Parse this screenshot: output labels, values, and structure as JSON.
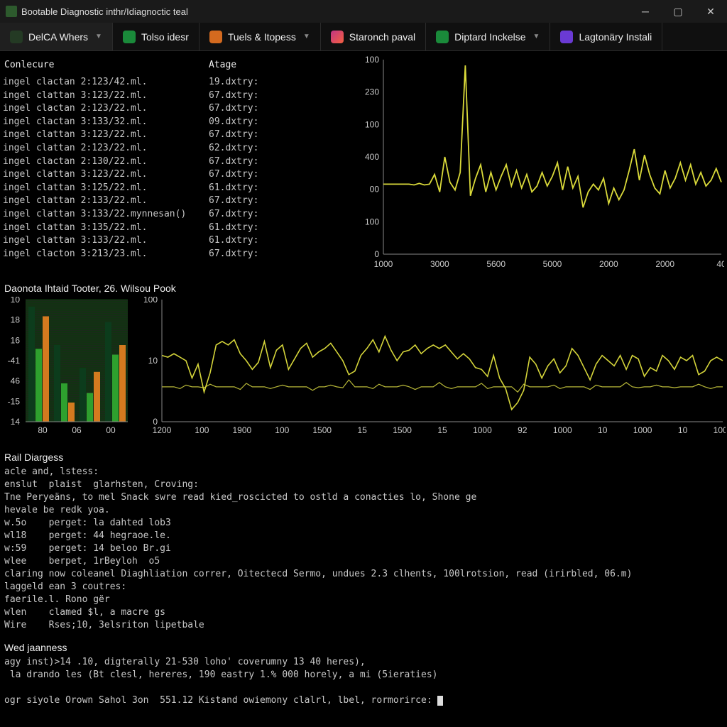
{
  "window": {
    "title": "Bootable Diagnostic inthr/Idiagnoctic teal"
  },
  "tabs": [
    {
      "label": "DelCA Whers",
      "icon_bg": "#243a24",
      "chevron": true
    },
    {
      "label": "Tolso idesr",
      "icon_bg": "#1a8a3a",
      "chevron": false
    },
    {
      "label": "Tuels & Itopess",
      "icon_bg": "#d46a1f",
      "chevron": true
    },
    {
      "label": "Staronch paval",
      "icon_bg": "linear-gradient(135deg,#c13584,#f56040)",
      "chevron": false
    },
    {
      "label": "Diptard Inckelse",
      "icon_bg": "#1a8a3a",
      "chevron": true
    },
    {
      "label": "Lagtonäry Instali",
      "icon_bg": "#6a3ad4",
      "chevron": false
    }
  ],
  "log": {
    "h1": "Conlecure",
    "h2": "Atage",
    "rows": [
      {
        "c1": "ingel clactan 2:123/42.ml.",
        "c2": "19.dxtry:"
      },
      {
        "c1": "ingel clattan 3:123/22.ml.",
        "c2": "67.dxtry:"
      },
      {
        "c1": "ingel clactan 2:123/22.ml.",
        "c2": "67.dxtry:"
      },
      {
        "c1": "ingel clactan 3:133/32.ml.",
        "c2": "09.dxtry:"
      },
      {
        "c1": "ingel clattan 3:123/22.ml.",
        "c2": "67.dxtry:"
      },
      {
        "c1": "ingel clattan 2:123/22.ml.",
        "c2": "62.dxtry:"
      },
      {
        "c1": "ingel clactan 2:130/22.ml.",
        "c2": "67.dxtry:"
      },
      {
        "c1": "ingel clattan 3:123/22.ml.",
        "c2": "67.dxtry:"
      },
      {
        "c1": "ingel clattan 3:125/22.ml.",
        "c2": "61.dxtry:"
      },
      {
        "c1": "ingel clattan 2:133/22.ml.",
        "c2": "67.dxtry:"
      },
      {
        "c1": "ingel clattan 3:133/22.mynnesan()",
        "c2": "67.dxtry:"
      },
      {
        "c1": "ingel clattan 3:135/22.ml.",
        "c2": "61.dxtry:"
      },
      {
        "c1": "ingel clattan 3:133/22.ml.",
        "c2": "61.dxtry:"
      },
      {
        "c1": "ingel clacton 3:213/23.ml.",
        "c2": "67.dxtry:"
      }
    ]
  },
  "mid_label": "Daonota Ihtaid Tooter, 26. Wilsou Pook",
  "section1": "Rail Diargess",
  "console1_lines": [
    "acle and, lstess:",
    "enslut  plaist  glarhsten, Croving:",
    "Tne Peryeäns, to mel Snack swre read kied_roscicted to ostld a conacties lo, Shone ge",
    "hevale be redk yoa.",
    "w.5o    perget: la dahted lob3",
    "wl18    perget: 44 hegraoe.le.",
    "w:59    perget: 14 beloo Br.gi",
    "wlee    berpet, 1rBeyloh  o5",
    "claring now coleanel Diaghliation correr, Oitectecd Sermo, undues 2.3 clhents, 100lrotsion, read (irirbled, 06.m)",
    "laggeld ean 3 coutres:",
    "faerile.l. Rono gër",
    "wlen    clamed $l, a macre gs",
    "Wire    Rses;10, 3elsriton lipetbale"
  ],
  "section2": "Wed jaanness",
  "console2_lines": [
    "agy inst)>14 .10, digterally 21-530 loho' coverumny 13 40 heres),",
    " la drando les (Bt clesl, hereres, 190 eastry 1.% 000 horely, a mi (5ieraties)",
    "",
    "ogr siyole Orown Sahol 3on  551.12 Kistand owiemony clalrl, lbel, rormorirce: "
  ],
  "chart_data": [
    {
      "type": "line",
      "title": "",
      "xticks": [
        "1000",
        "3000",
        "5600",
        "5000",
        "2000",
        "2000",
        "40"
      ],
      "yticks": [
        "0",
        "100",
        "00",
        "400",
        "100",
        "230",
        "100"
      ],
      "ylim": [
        0,
        500
      ],
      "x": [
        0,
        1,
        2,
        3,
        4,
        5,
        6,
        7,
        8,
        9,
        10,
        11,
        12,
        13,
        14,
        15,
        16,
        17,
        18,
        19,
        20,
        21,
        22,
        23,
        24,
        25,
        26,
        27,
        28,
        29,
        30,
        31,
        32,
        33,
        34,
        35,
        36,
        37,
        38,
        39,
        40,
        41,
        42,
        43,
        44,
        45,
        46,
        47,
        48,
        49,
        50,
        51,
        52,
        53,
        54,
        55,
        56,
        57,
        58,
        59,
        60,
        61,
        62,
        63,
        64,
        65,
        66
      ],
      "y": [
        180,
        180,
        180,
        180,
        180,
        180,
        178,
        182,
        178,
        180,
        205,
        160,
        250,
        185,
        165,
        210,
        485,
        150,
        195,
        230,
        160,
        210,
        165,
        200,
        230,
        175,
        215,
        170,
        205,
        160,
        175,
        210,
        175,
        200,
        235,
        165,
        225,
        170,
        200,
        120,
        160,
        180,
        165,
        195,
        130,
        170,
        140,
        165,
        215,
        270,
        190,
        255,
        205,
        170,
        155,
        215,
        170,
        195,
        235,
        190,
        230,
        180,
        210,
        175,
        190,
        220,
        185
      ]
    },
    {
      "type": "bar",
      "yticks": [
        "14",
        "-15",
        "46",
        "-41",
        "16",
        "18",
        "10"
      ],
      "xticks": [
        "80",
        "06",
        "00"
      ],
      "series": [
        {
          "name": "dark",
          "values": [
            60,
            40,
            28,
            52
          ]
        },
        {
          "name": "green",
          "values": [
            38,
            20,
            15,
            35
          ]
        },
        {
          "name": "orange",
          "values": [
            55,
            10,
            26,
            40
          ]
        }
      ]
    },
    {
      "type": "line",
      "yticks": [
        "0",
        "10",
        "100"
      ],
      "xticks": [
        "1200",
        "100",
        "1900",
        "100",
        "1500",
        "15",
        "1500",
        "15",
        "1000",
        "92",
        "1000",
        "10",
        "1000",
        "10",
        "1000"
      ],
      "ylim": [
        -40,
        100
      ],
      "x": [
        0,
        1,
        2,
        3,
        4,
        5,
        6,
        7,
        8,
        9,
        10,
        11,
        12,
        13,
        14,
        15,
        16,
        17,
        18,
        19,
        20,
        21,
        22,
        23,
        24,
        25,
        26,
        27,
        28,
        29,
        30,
        31,
        32,
        33,
        34,
        35,
        36,
        37,
        38,
        39,
        40,
        41,
        42,
        43,
        44,
        45,
        46,
        47,
        48,
        49,
        50,
        51,
        52,
        53,
        54,
        55,
        56,
        57,
        58,
        59,
        60,
        61,
        62,
        63,
        64,
        65,
        66,
        67,
        68,
        69,
        70,
        71,
        72,
        73,
        74,
        75,
        76,
        77,
        78,
        79,
        80,
        81,
        82,
        83,
        84,
        85,
        86,
        87,
        88,
        89,
        90,
        91,
        92,
        93
      ],
      "y": [
        36,
        34,
        38,
        34,
        30,
        10,
        26,
        -6,
        16,
        48,
        52,
        48,
        54,
        38,
        30,
        20,
        28,
        52,
        22,
        42,
        48,
        20,
        32,
        44,
        50,
        34,
        40,
        44,
        50,
        40,
        30,
        14,
        18,
        36,
        44,
        54,
        40,
        58,
        42,
        30,
        40,
        42,
        48,
        38,
        44,
        48,
        44,
        48,
        40,
        32,
        38,
        32,
        22,
        20,
        12,
        36,
        10,
        -2,
        -26,
        -18,
        -4,
        34,
        26,
        10,
        24,
        32,
        16,
        24,
        44,
        36,
        22,
        8,
        26,
        36,
        30,
        24,
        36,
        20,
        36,
        32,
        12,
        22,
        18,
        36,
        30,
        20,
        34,
        30,
        36,
        14,
        18,
        30,
        34,
        30
      ],
      "baseline_y": 0,
      "baseline_jitter": [
        0,
        0,
        0,
        -2,
        2,
        0,
        0,
        -1,
        3,
        0,
        0,
        0,
        0,
        -3,
        4,
        0,
        0,
        0,
        -2,
        0,
        2,
        0,
        0,
        0,
        0,
        -4,
        0,
        0,
        2,
        0,
        -1,
        8,
        0,
        0,
        0,
        -2,
        3,
        0,
        0,
        0,
        2,
        0,
        -3,
        0,
        0,
        0,
        5,
        0,
        -2,
        0,
        0,
        0,
        0,
        4,
        -2,
        0,
        0,
        0,
        0,
        -6,
        3,
        0,
        0,
        0,
        0,
        2,
        -2,
        0,
        0,
        0,
        0,
        -3,
        2,
        0,
        0,
        0,
        0,
        5,
        0,
        -1,
        0,
        0,
        2,
        0,
        0,
        -1,
        0,
        0,
        0,
        3,
        0,
        -2,
        0,
        0
      ]
    }
  ]
}
